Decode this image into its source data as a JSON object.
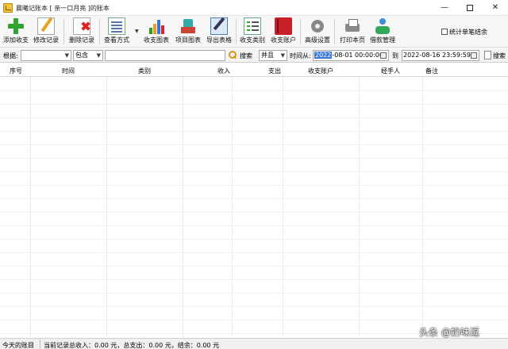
{
  "window": {
    "title": "晨曦记账本    [ 亲一口月亮 ]的账本"
  },
  "toolbar": {
    "add": "添加收支",
    "edit": "修改记录",
    "delete": "删除记录",
    "view_mode": "查看方式",
    "income_chart": "收支图表",
    "project_chart": "项目图表",
    "export_sheet": "导出表格",
    "categories": "收支类别",
    "accounts": "收支账户",
    "advanced": "高级设置",
    "print": "打印本页",
    "loan": "借款管理",
    "stat_check": "统计单笔结余"
  },
  "filter": {
    "by_label": "根据:",
    "by_value": "",
    "match_value": "包含",
    "keyword": "",
    "search": "搜索",
    "logic_value": "并且",
    "time_from": "时间从:",
    "date_from_selected": "2022",
    "date_from_rest": "-08-01 00:00:00",
    "to": "到",
    "date_to": "2022-08-16 23:59:59",
    "search2": "搜索"
  },
  "table": {
    "columns": [
      "序号",
      "时间",
      "类别",
      "收入",
      "支出",
      "收支账户",
      "经手人",
      "备注"
    ],
    "rows": []
  },
  "status": {
    "today": "今天的账目",
    "summary": "当前记录总收入：0.00 元，总支出：0.00 元，结余：0.00 元"
  },
  "watermark": "头条 @奶味逗"
}
